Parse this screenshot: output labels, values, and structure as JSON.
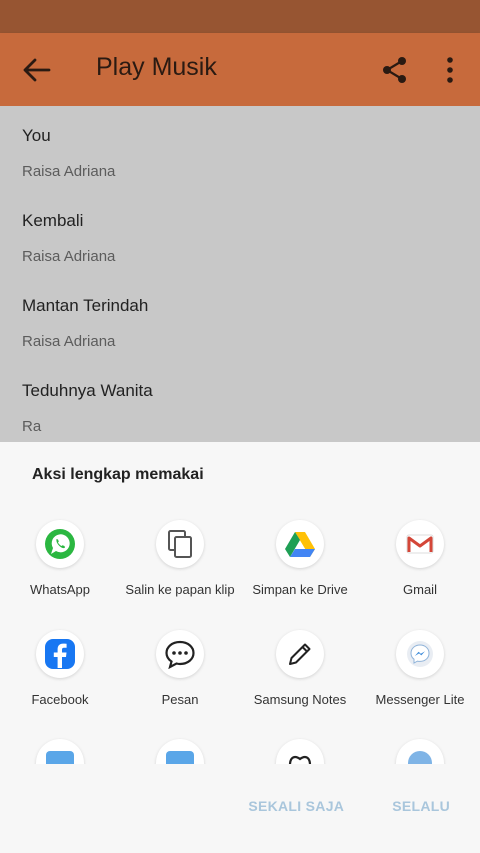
{
  "app_bar": {
    "title": "Play Musik",
    "back_icon": "arrow-left-icon",
    "share_icon": "share-icon",
    "more_icon": "more-vert-icon"
  },
  "songs": [
    {
      "title": "You",
      "artist": "Raisa Adriana"
    },
    {
      "title": "Kembali",
      "artist": "Raisa Adriana"
    },
    {
      "title": "Mantan Terindah",
      "artist": "Raisa Adriana"
    },
    {
      "title": "Teduhnya Wanita",
      "artist": "Ra"
    }
  ],
  "share_sheet": {
    "heading": "Aksi lengkap memakai",
    "apps": [
      {
        "label": "WhatsApp",
        "icon": "whatsapp-icon"
      },
      {
        "label": "Salin ke papan klip",
        "icon": "copy-icon"
      },
      {
        "label": "Simpan ke Drive",
        "icon": "google-drive-icon"
      },
      {
        "label": "Gmail",
        "icon": "gmail-icon"
      },
      {
        "label": "Facebook",
        "icon": "facebook-icon"
      },
      {
        "label": "Pesan",
        "icon": "message-icon"
      },
      {
        "label": "Samsung Notes",
        "icon": "pen-icon"
      },
      {
        "label": "Messenger Lite",
        "icon": "messenger-lite-icon"
      }
    ],
    "buttons": {
      "once": "SEKALI SAJA",
      "always": "SELALU"
    }
  },
  "colors": {
    "status_bar": "#975532",
    "app_bar": "#c76a3c",
    "dim_overlay": "#c8c8c8",
    "sheet_bg": "#f7f7f7",
    "action_text": "#a9c6dc"
  }
}
